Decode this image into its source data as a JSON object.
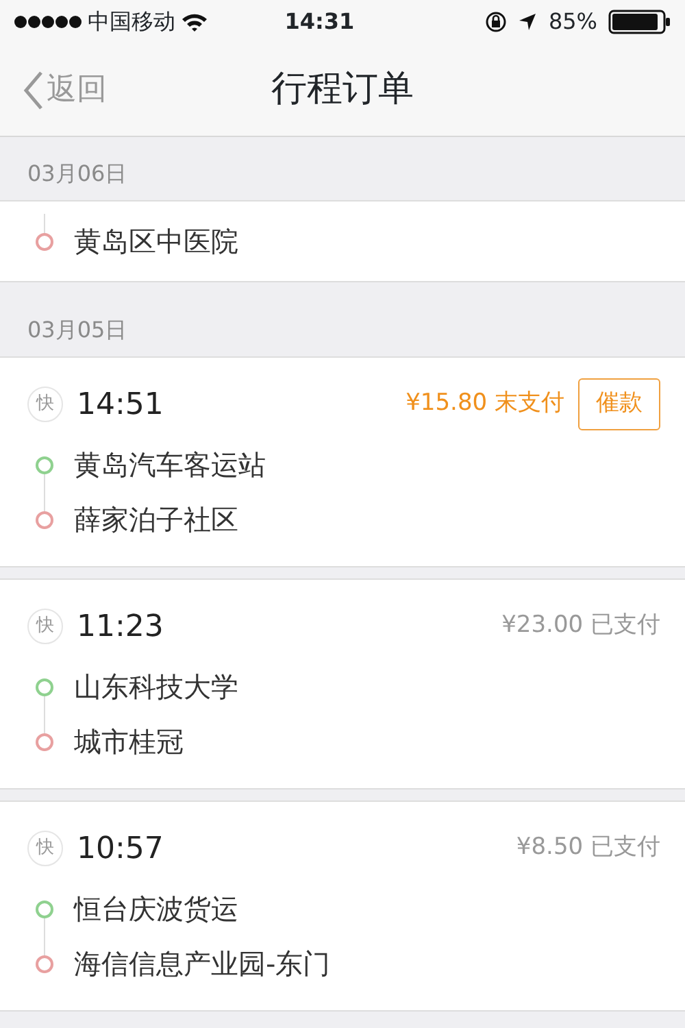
{
  "status_bar": {
    "carrier": "中国移动",
    "time": "14:31",
    "battery": "85%"
  },
  "nav": {
    "back": "返回",
    "title": "行程订单"
  },
  "groups": [
    {
      "date": "03月06日",
      "orders": [
        {
          "kind": "simple",
          "stops": [
            {
              "name": "黄岛区中医院",
              "color": "#e8a0a0"
            }
          ]
        }
      ]
    },
    {
      "date": "03月05日",
      "orders": [
        {
          "kind": "trip",
          "badge": "快",
          "time": "14:51",
          "price": "¥15.80",
          "status": "末支付",
          "paid": false,
          "action": "催款",
          "stops": [
            {
              "name": "黄岛汽车客运站",
              "color": "#8fd18f"
            },
            {
              "name": "薛家泊子社区",
              "color": "#e8a0a0"
            }
          ]
        },
        {
          "kind": "trip",
          "badge": "快",
          "time": "11:23",
          "price": "¥23.00",
          "status": "已支付",
          "paid": true,
          "stops": [
            {
              "name": "山东科技大学",
              "color": "#8fd18f"
            },
            {
              "name": "城市桂冠",
              "color": "#e8a0a0"
            }
          ]
        },
        {
          "kind": "trip",
          "badge": "快",
          "time": "10:57",
          "price": "¥8.50",
          "status": "已支付",
          "paid": true,
          "stops": [
            {
              "name": "恒台庆波货运",
              "color": "#8fd18f"
            },
            {
              "name": "海信信息产业园-东门",
              "color": "#e8a0a0"
            }
          ]
        }
      ]
    }
  ]
}
